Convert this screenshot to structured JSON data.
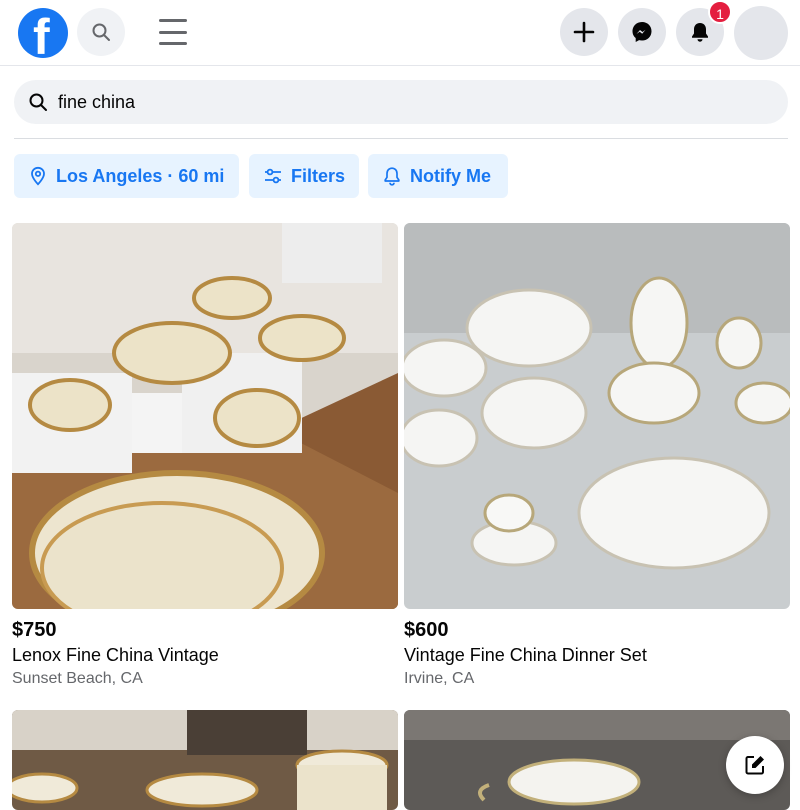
{
  "header": {
    "logo_letter": "f",
    "notification_count": "1",
    "icons": [
      "facebook-logo",
      "search-icon",
      "menu-icon",
      "plus-icon",
      "messenger-icon",
      "bell-icon",
      "avatar"
    ]
  },
  "search": {
    "query": "fine china"
  },
  "filters": {
    "location": "Los Angeles · 60 mi",
    "filters_label": "Filters",
    "notify_label": "Notify Me"
  },
  "listings": [
    {
      "price": "$750",
      "title": "Lenox Fine China Vintage",
      "location": "Sunset Beach, CA"
    },
    {
      "price": "$600",
      "title": "Vintage Fine China Dinner Set",
      "location": "Irvine, CA"
    }
  ],
  "colors": {
    "brand": "#1877f2",
    "chip_bg": "#e7f3ff",
    "badge": "#e41e3f"
  }
}
